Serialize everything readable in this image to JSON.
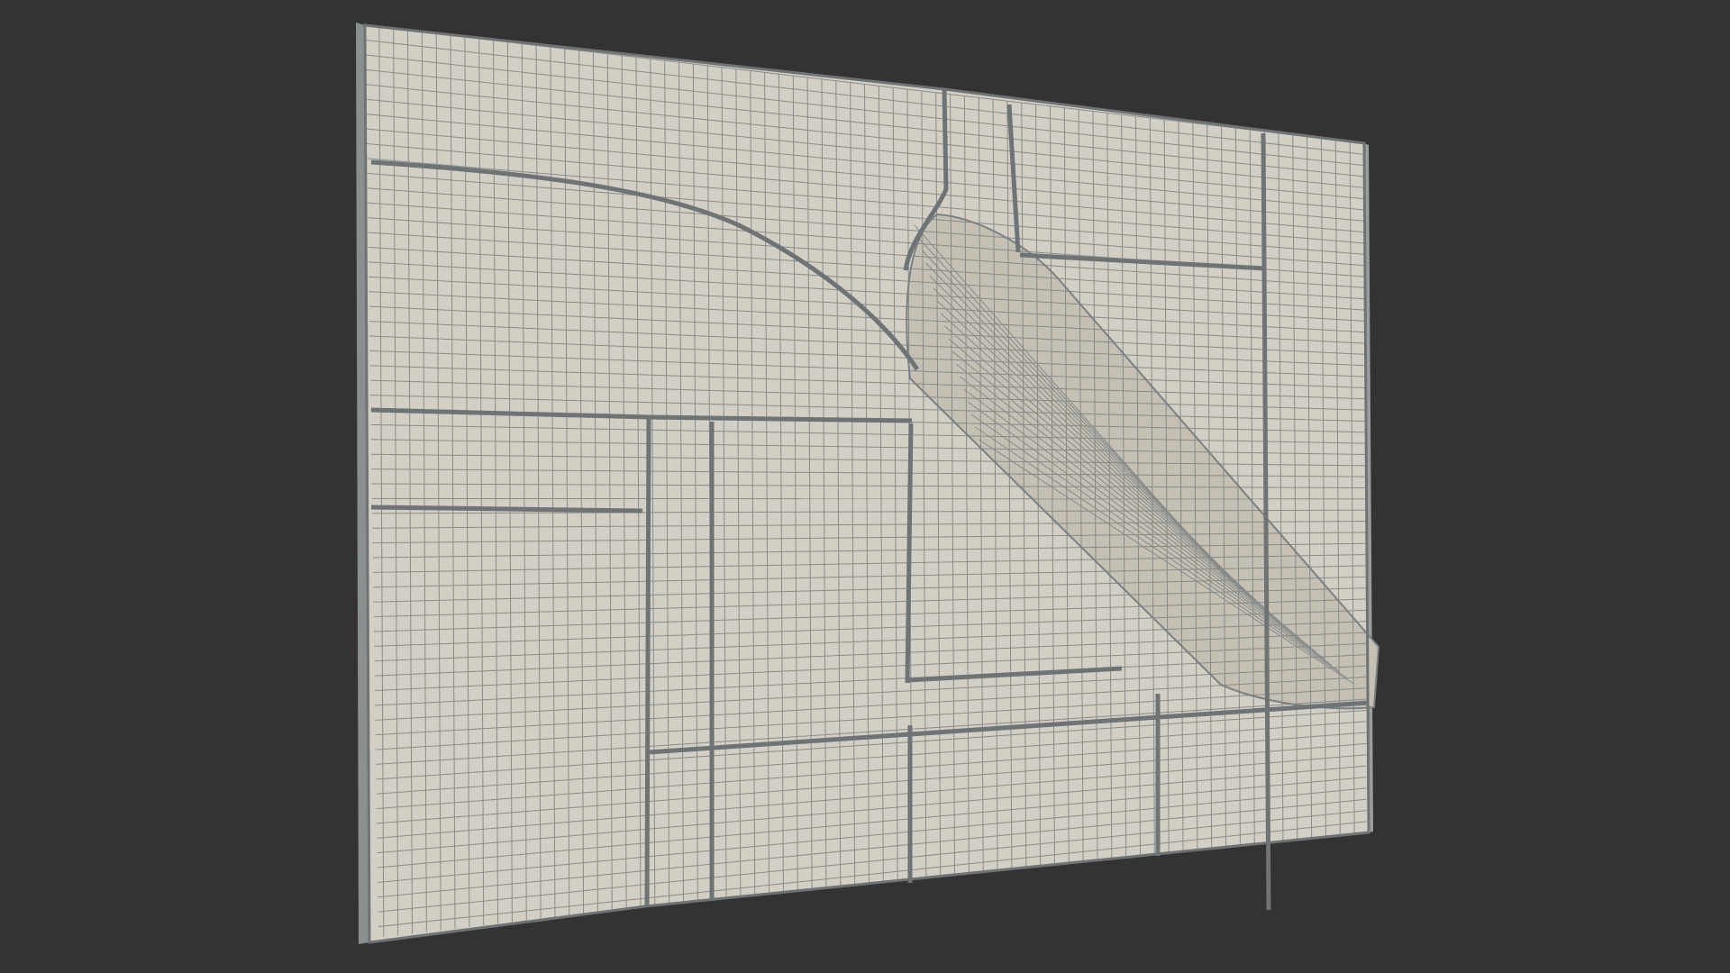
{
  "viewport": {
    "background": "#333333",
    "render_mode": "wireframe-on-shaded",
    "visible_text": []
  },
  "model": {
    "kind": "wall panel mesh with diagonal tube",
    "surface_color": "#d4cfc5",
    "shaded_color": "#c9c3b7",
    "edge_color": "#8a8f90",
    "wire_color": "#7b8082",
    "seam_color": "#6e7375"
  }
}
